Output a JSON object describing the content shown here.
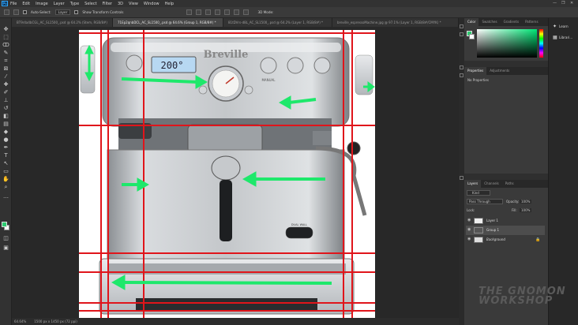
{
  "menu": {
    "logo": "Ps",
    "items": [
      "File",
      "Edit",
      "Image",
      "Layer",
      "Type",
      "Select",
      "Filter",
      "3D",
      "View",
      "Window",
      "Help"
    ],
    "window_controls": [
      "—",
      "❐",
      "✕"
    ]
  },
  "options": {
    "auto_select_label": "Auto-Select:",
    "auto_select_value": "Layer",
    "transform_label": "Show Transform Controls",
    "mode_3d_label": "3D Mode:"
  },
  "tabs": [
    {
      "label": "BT9r4a4bCGL_AC_SL1500_.psd @ 64.2% (Stem, RGB/8#)",
      "active": false
    },
    {
      "label": "71Ep2qnbDCL_AC_SL1500_.psd @ 64.6% (Group 1, RGB/8#) *",
      "active": true
    },
    {
      "label": "81tDVrs-d8L_AC_SL1500_.psd @ 64.2% (Layer 1, RGB/8#) *",
      "active": false
    },
    {
      "label": "breville_espressoMachine.jpg @ 97.1% (Layer 1, RGB/8#/CMYK) *",
      "active": false
    }
  ],
  "artwork": {
    "brand": "Breville",
    "display_value": "200°",
    "side_label_left": "MANUAL",
    "bottom_badge": "DUAL WALL",
    "arrow_color": "#1ee86b",
    "guide_color": "#e0151b"
  },
  "status": {
    "zoom": "64.64%",
    "doc_size": "1500 px x 1450 px (72 ppi)"
  },
  "color_panel": {
    "tabs": [
      "Color",
      "Swatches",
      "Gradients",
      "Patterns"
    ],
    "foreground": "#2ecc71",
    "hue_color": "#00e676"
  },
  "properties_panel": {
    "tabs": [
      "Properties",
      "Adjustments"
    ],
    "empty_text": "No Properties"
  },
  "layers_panel": {
    "tabs": [
      "Layers",
      "Channels",
      "Paths"
    ],
    "filter_label": "Kind",
    "blend_mode": "Pass Through",
    "opacity_label": "Opacity:",
    "opacity_value": "100%",
    "lock_label": "Lock:",
    "fill_label": "Fill:",
    "fill_value": "100%",
    "layers": [
      {
        "name": "Layer 1",
        "selected": false
      },
      {
        "name": "Group 1",
        "selected": true
      },
      {
        "name": "Background",
        "selected": false
      }
    ]
  },
  "learn_panel": {
    "items": [
      "Learn",
      "Librari..."
    ]
  },
  "watermark": {
    "line1": "THE GNOMON",
    "line2": "WORKSHOP"
  }
}
